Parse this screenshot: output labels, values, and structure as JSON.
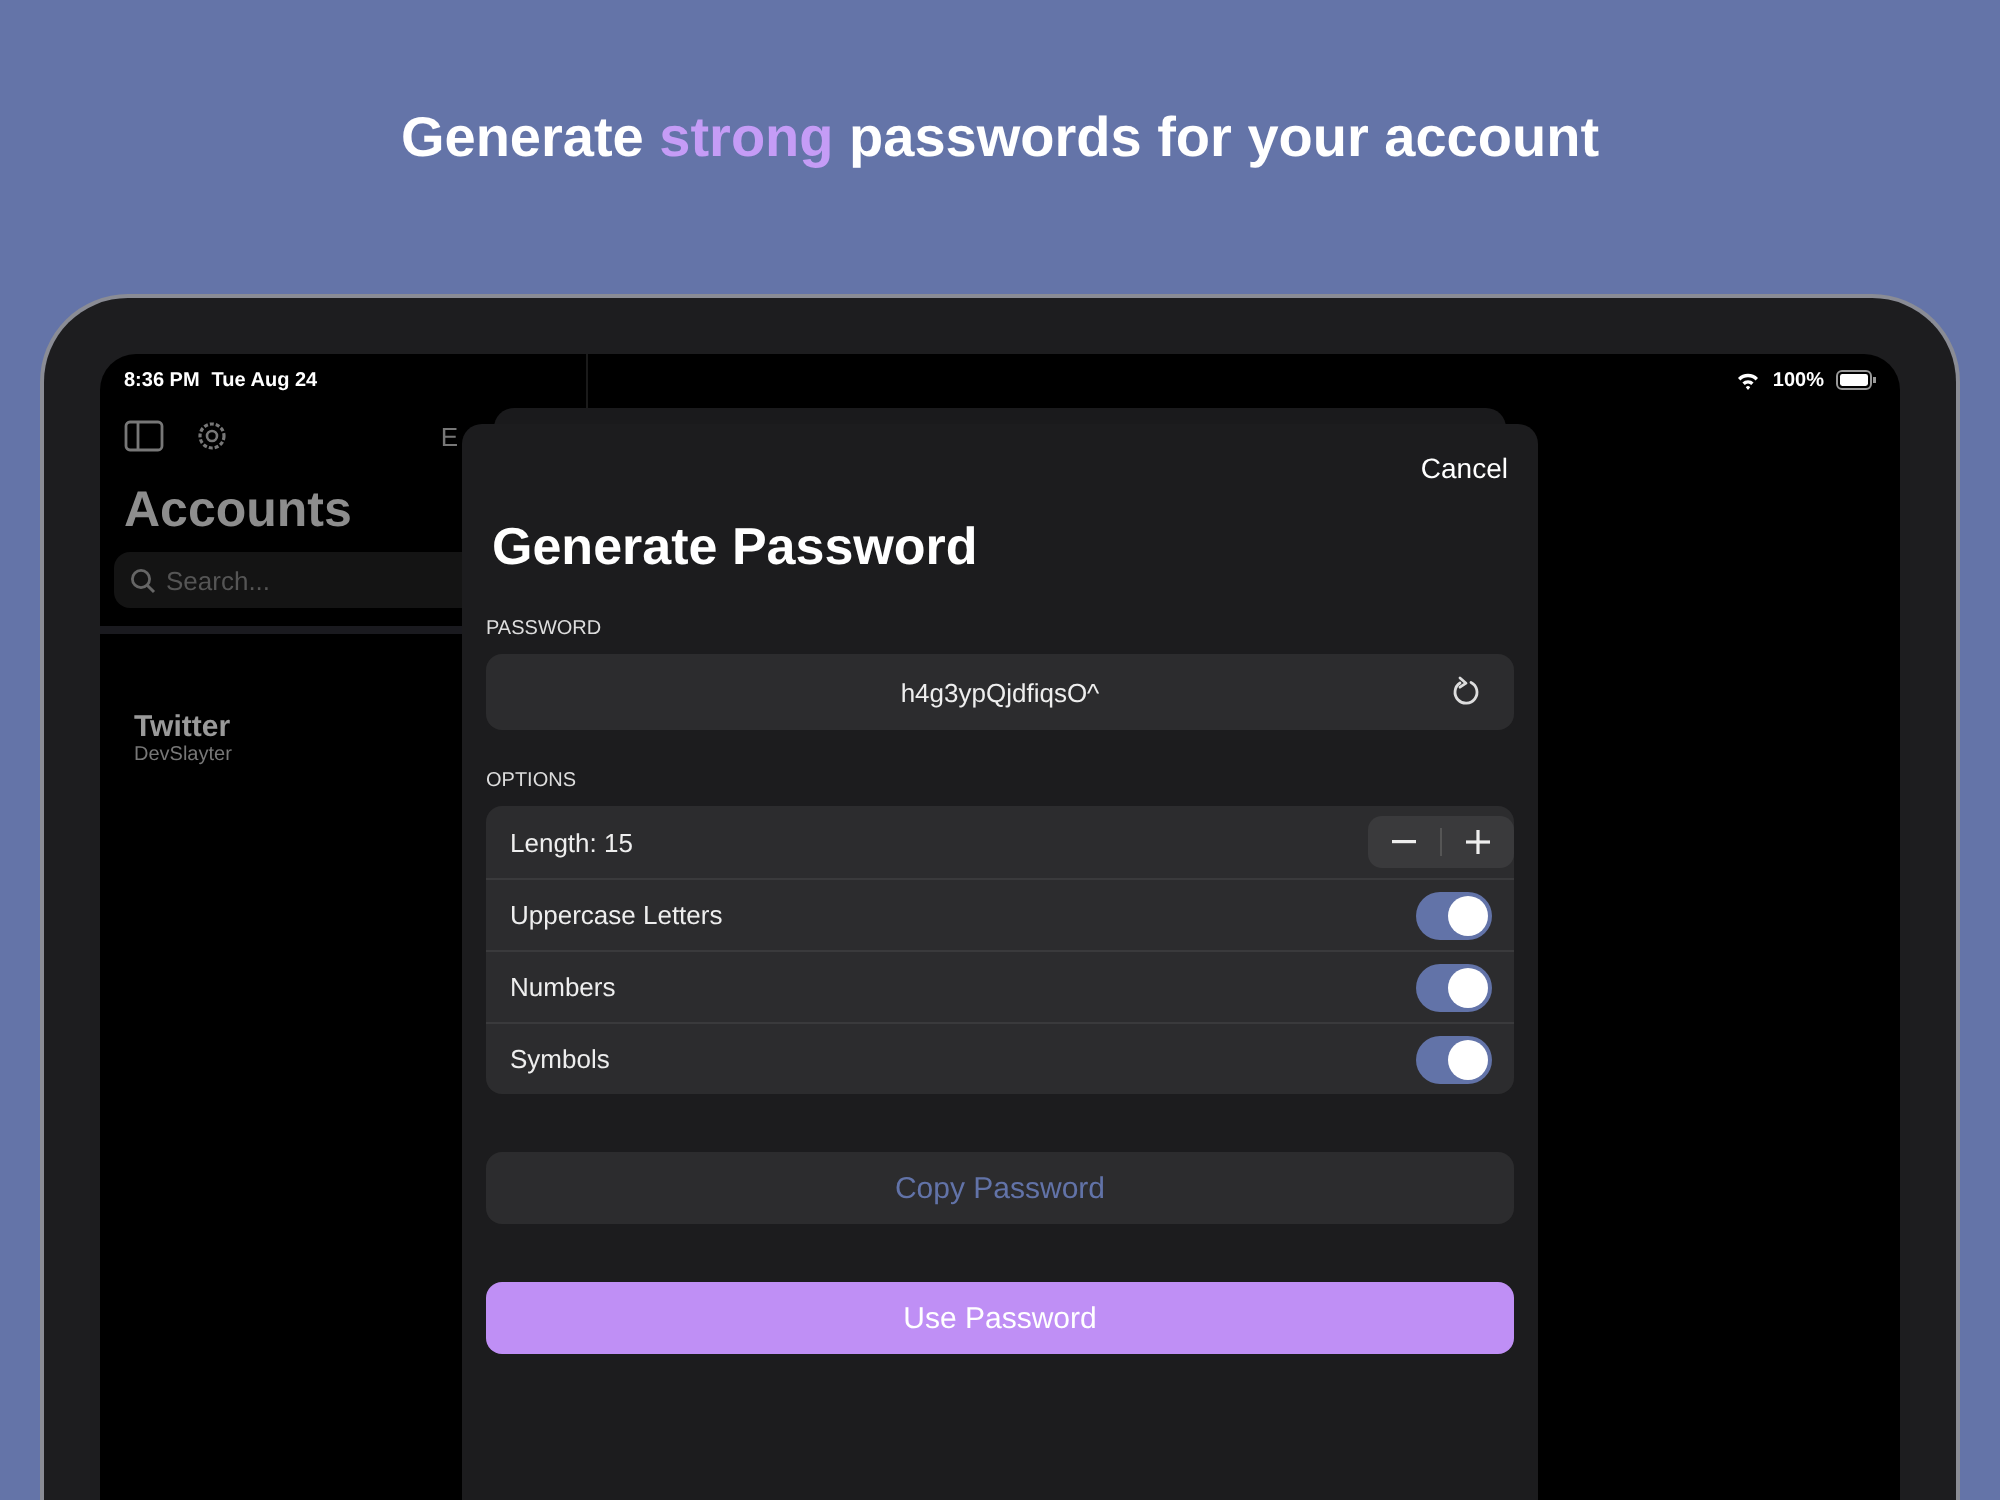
{
  "headline": {
    "before": "Generate",
    "highlight": "strong",
    "after": "passwords for your account"
  },
  "status_bar": {
    "time": "8:36 PM",
    "date": "Tue Aug 24",
    "battery": "100%"
  },
  "sidebar": {
    "edit_partial": "E",
    "title": "Accounts",
    "search": {
      "placeholder": "Search..."
    },
    "items": [
      {
        "name": "Twitter",
        "username": "DevSlayter"
      }
    ]
  },
  "sheet": {
    "cancel": "Cancel",
    "title": "Generate Password",
    "password_label": "PASSWORD",
    "password": "h4g3ypQjdfiqsO^",
    "options_label": "OPTIONS",
    "options": [
      {
        "kind": "stepper",
        "label": "Length: 15"
      },
      {
        "kind": "toggle",
        "label": "Uppercase Letters",
        "on": true
      },
      {
        "kind": "toggle",
        "label": "Numbers",
        "on": true
      },
      {
        "kind": "toggle",
        "label": "Symbols",
        "on": true
      }
    ],
    "copy_button": {
      "label": "Copy Password",
      "disabled": true
    },
    "use_button": "Use Password"
  }
}
